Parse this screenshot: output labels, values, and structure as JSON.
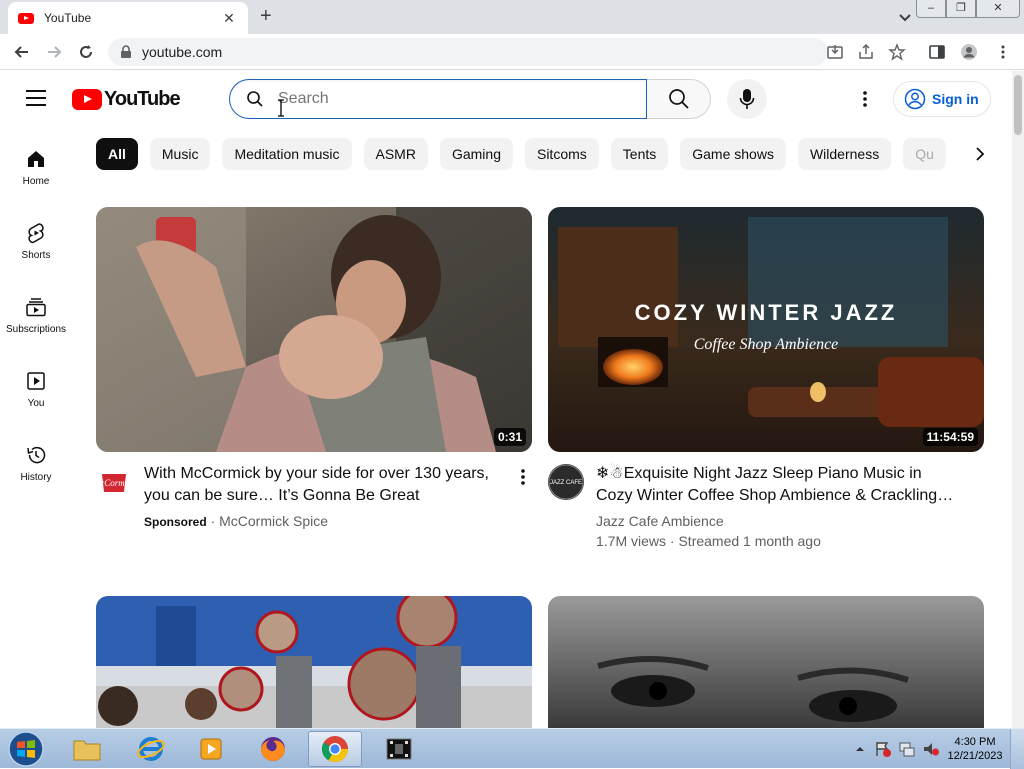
{
  "browser": {
    "tab_title": "YouTube",
    "url": "youtube.com"
  },
  "youtube": {
    "logo_text": "YouTube",
    "search_placeholder": "Search",
    "sign_in_label": "Sign in",
    "chips": [
      "All",
      "Music",
      "Meditation music",
      "ASMR",
      "Gaming",
      "Sitcoms",
      "Tents",
      "Game shows",
      "Wilderness",
      "Qu"
    ],
    "guide": [
      {
        "label": "Home",
        "icon": "home-icon"
      },
      {
        "label": "Shorts",
        "icon": "shorts-icon"
      },
      {
        "label": "Subscriptions",
        "icon": "subscriptions-icon"
      },
      {
        "label": "You",
        "icon": "you-icon"
      },
      {
        "label": "History",
        "icon": "history-icon"
      }
    ],
    "videos": [
      {
        "title_line1": "With McCormick by your side for over 130 years,",
        "title_line2": "you can be sure… It’s Gonna Be Great",
        "sponsored": "Sponsored",
        "channel": "McCormick Spice",
        "duration": "0:31"
      },
      {
        "title_line1": "❄☃Exquisite Night Jazz Sleep Piano Music in",
        "title_line2": "Cozy Winter Coffee Shop Ambience & Crackling…",
        "channel": "Jazz Cafe Ambience",
        "stats": "1.7M views · Streamed 1 month ago",
        "duration": "11:54:59",
        "thumb_heading": "COZY WINTER JAZZ",
        "thumb_sub": "Coffee Shop Ambience"
      }
    ],
    "avatar_text": "JAZZ CAFE",
    "mccormick_logo": "McCormick"
  },
  "taskbar": {
    "time": "4:30 PM",
    "date": "12/21/2023"
  },
  "colors": {
    "accent_blue": "#065fd4",
    "youtube_red": "#ff0000"
  }
}
